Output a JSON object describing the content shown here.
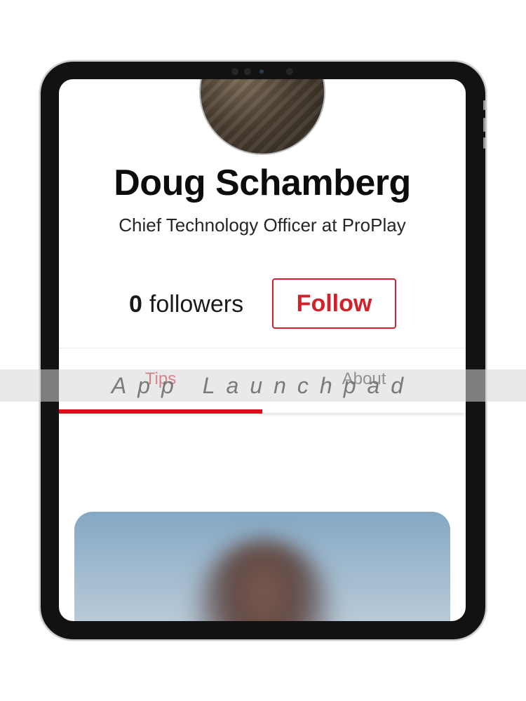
{
  "profile": {
    "name": "Doug Schamberg",
    "role": "Chief Technology Officer at ProPlay",
    "followers_count": "0",
    "followers_label": "followers",
    "follow_button_label": "Follow"
  },
  "tabs": [
    {
      "label": "Tips",
      "active": true
    },
    {
      "label": "About",
      "active": false
    }
  ],
  "watermark": "App Launchpad",
  "colors": {
    "accent": "#d0222a",
    "device_frame": "#121212",
    "text_primary": "#0c0c0c"
  }
}
